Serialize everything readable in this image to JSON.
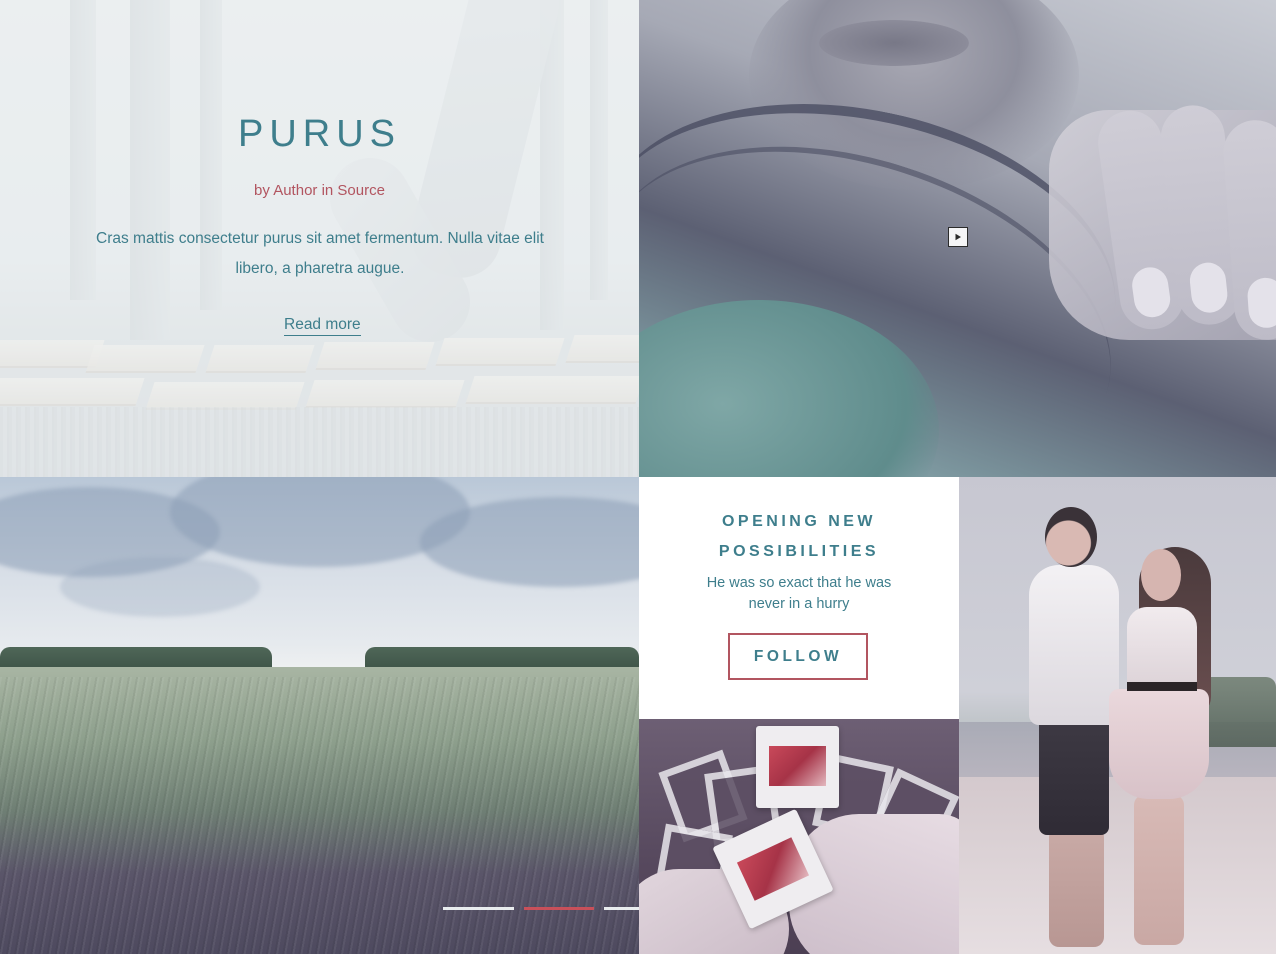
{
  "hero": {
    "title": "PURUS",
    "byline": "by Author in Source",
    "excerpt": "Cras mattis consectetur purus sit amet fermentum. Nulla vitae elit libero, a pharetra augue.",
    "read_more": "Read more"
  },
  "video": {
    "play_icon": "play-icon"
  },
  "cta": {
    "title": "OPENING NEW POSSIBILITIES",
    "subtitle": "He was so exact that he was never in a hurry",
    "button": "FOLLOW"
  },
  "slider": {
    "slide_count": 5,
    "active_slide": 2
  },
  "colors": {
    "accent_teal": "#3e7e8c",
    "accent_rose": "#b25560",
    "progress_inactive": "#e8ecee",
    "progress_active": "#c8505a"
  }
}
